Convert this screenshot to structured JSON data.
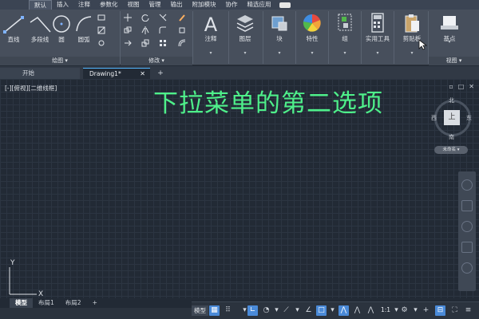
{
  "ribbon_tabs": [
    "默认",
    "插入",
    "注释",
    "参数化",
    "视图",
    "管理",
    "输出",
    "附加模块",
    "协作",
    "精选应用"
  ],
  "draw_panel": {
    "line": "直线",
    "polyline": "多段线",
    "circle": "圆",
    "arc": "圆弧",
    "footer": "绘图"
  },
  "modify_panel": {
    "footer": "修改"
  },
  "big_buttons": {
    "annotation": "注释",
    "layers": "图层",
    "block": "块",
    "properties": "特性",
    "groups": "组",
    "utilities": "实用工具",
    "clipboard": "剪贴板",
    "base": "基点",
    "view_footer": "视图"
  },
  "file_tabs": {
    "start": "开始",
    "drawing": "Drawing1*",
    "plus": "+"
  },
  "canvas": {
    "viewport_label": "[-][俯视][二维线框]",
    "overlay_title": "下拉菜单的第二选项",
    "viewcube": {
      "north": "北",
      "south": "南",
      "east": "东",
      "west": "西",
      "face": "上"
    },
    "wcs": "未命名 ▾",
    "ucs_y": "Y",
    "ucs_x": "X"
  },
  "layout_tabs": [
    "模型",
    "布局1",
    "布局2",
    "+"
  ],
  "status_bar": {
    "model": "模型",
    "scale": "1:1"
  },
  "colors": {
    "overlay_title": "#4ef08a",
    "accent": "#4a8ad8"
  }
}
